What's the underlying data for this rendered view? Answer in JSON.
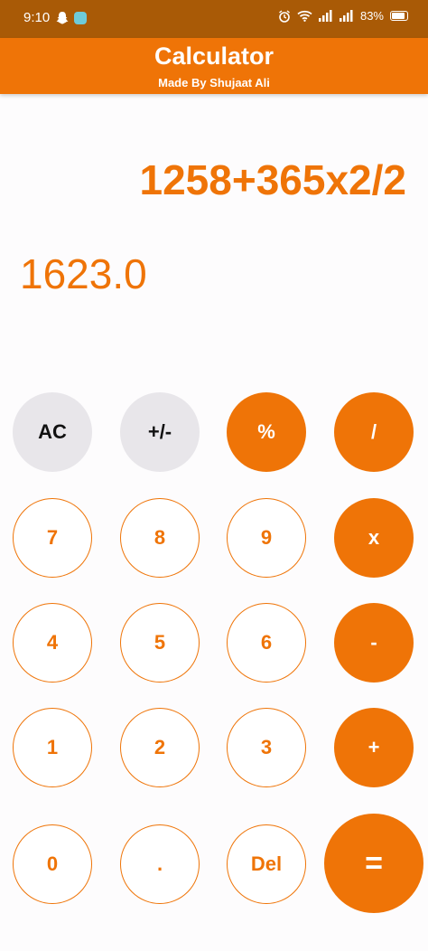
{
  "status_bar": {
    "time": "9:10",
    "battery": "83%",
    "battery_level": 0.83
  },
  "app_bar": {
    "title": "Calculator",
    "subtitle": "Made By Shujaat Ali"
  },
  "display": {
    "expression": "1258+365x2/2",
    "result": "1623.0"
  },
  "keys": {
    "ac": "AC",
    "plus_minus": "+/-",
    "percent": "%",
    "divide": "/",
    "seven": "7",
    "eight": "8",
    "nine": "9",
    "multiply": "x",
    "four": "4",
    "five": "5",
    "six": "6",
    "minus": "-",
    "one": "1",
    "two": "2",
    "three": "3",
    "plus": "+",
    "zero": "0",
    "dot": ".",
    "del": "Del",
    "equals": "="
  },
  "colors": {
    "accent": "#ef7407",
    "status_bar": "#a95a06",
    "gray_key": "#e8e6ea"
  }
}
